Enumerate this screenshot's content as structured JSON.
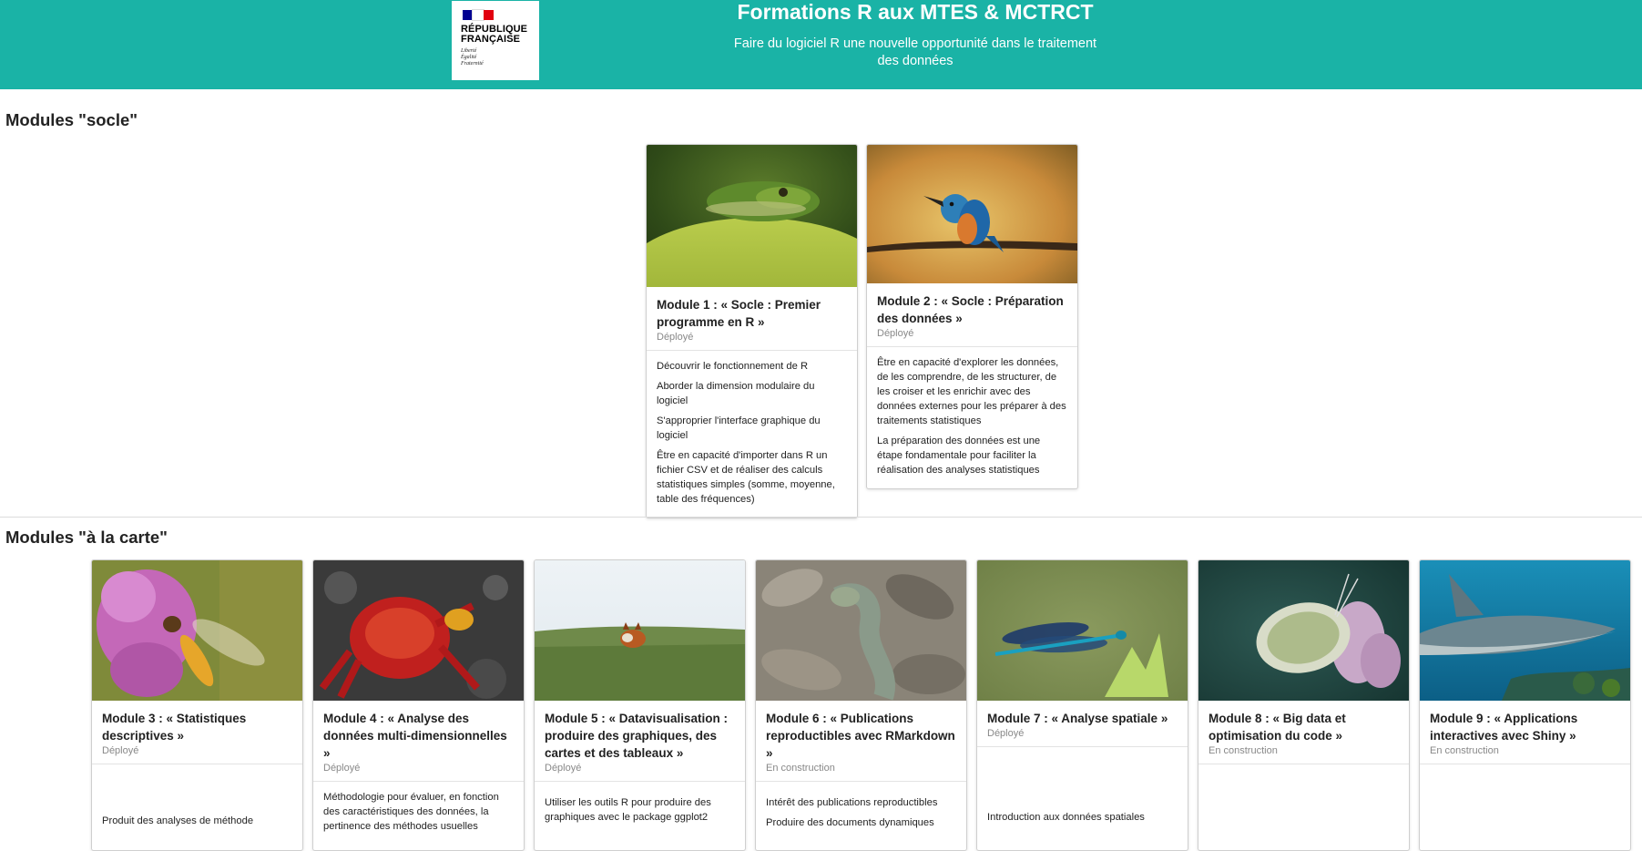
{
  "header": {
    "logo": {
      "republic": "RÉPUBLIQUE\nFRANÇAISE",
      "motto": "Liberté\nÉgalité\nFraternité",
      "colors": [
        "#000091",
        "#ffffff",
        "#e1000f"
      ]
    },
    "title": "Formations R aux MTES & MCTRCT",
    "subtitle": "Faire du logiciel R une nouvelle opportunité dans le traitement des données",
    "background": "#1ab3a6"
  },
  "sections": [
    {
      "title": "Modules \"socle\"",
      "cards": [
        {
          "title": "Module 1 : « Socle : Premier programme en R »",
          "status": "Déployé",
          "image": "frog",
          "lines": [
            "Découvrir le fonctionnement de R",
            "Aborder la dimension modulaire du logiciel",
            "S'approprier l'interface graphique du logiciel",
            "Être en capacité d'importer dans R un fichier CSV et de réaliser des calculs statistiques simples (somme, moyenne, table des fréquences)"
          ]
        },
        {
          "title": "Module 2 : « Socle : Préparation des données »",
          "status": "Déployé",
          "image": "kingfisher",
          "lines": [
            "Être en capacité d'explorer les données, de les comprendre, de les structurer, de les croiser et les enrichir avec des données externes pour les préparer à des traitements statistiques",
            "La préparation des données est une étape fondamentale pour faciliter la réalisation des analyses statistiques"
          ]
        }
      ]
    },
    {
      "title": "Modules \"à la carte\"",
      "cards": [
        {
          "title": "Module 3 : « Statistiques descriptives »",
          "status": "Déployé",
          "image": "hoverfly",
          "lines": [
            "Produit des analyses de méthode"
          ]
        },
        {
          "title": "Module 4 : « Analyse des données multi-dimensionnelles »",
          "status": "Déployé",
          "image": "crab",
          "lines": [
            "Méthodologie pour évaluer, en fonction des caractéristiques des données, la pertinence des méthodes usuelles"
          ]
        },
        {
          "title": "Module 5 : « Datavisualisation : produire des graphiques, des cartes et des tableaux »",
          "status": "Déployé",
          "image": "fox",
          "lines": [
            "Utiliser les outils R pour produire des graphiques avec le package ggplot2"
          ]
        },
        {
          "title": "Module 6 : « Publications reproductibles avec RMarkdown »",
          "status": "En construction",
          "image": "snake",
          "lines": [
            "Intérêt des publications reproductibles",
            "Produire des documents dynamiques"
          ]
        },
        {
          "title": "Module 7 : « Analyse spatiale »",
          "status": "Déployé",
          "image": "damselfly",
          "lines": [
            "Introduction aux données spatiales"
          ]
        },
        {
          "title": "Module 8 : « Big data et optimisation du code »",
          "status": "En construction",
          "image": "butterfly",
          "lines": []
        },
        {
          "title": "Module 9 : « Applications interactives avec Shiny »",
          "status": "En construction",
          "image": "shark",
          "lines": []
        }
      ]
    }
  ]
}
